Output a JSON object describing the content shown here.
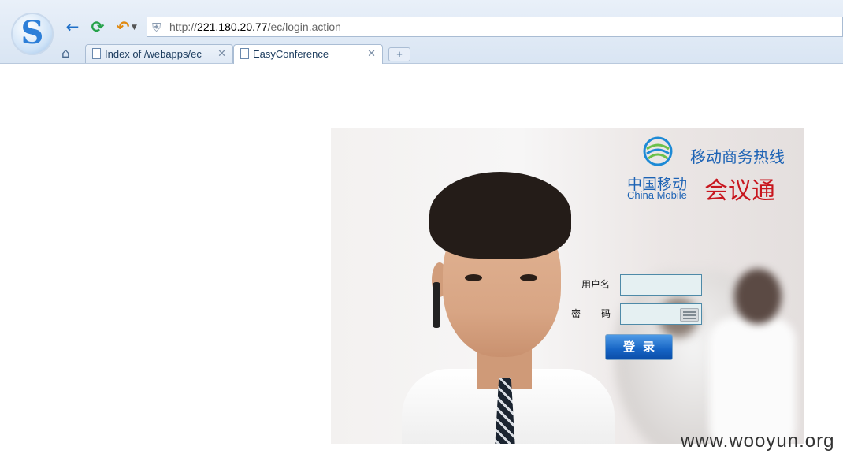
{
  "browser": {
    "url_plain": "http://",
    "url_host": "221.180.20.77",
    "url_path": "/ec/login.action",
    "tabs": [
      {
        "label": "Index of /webapps/ec",
        "active": false
      },
      {
        "label": "EasyConference",
        "active": true
      }
    ],
    "new_tab_label": "+",
    "icons": [
      "back-arrow-icon",
      "reload-icon",
      "undo-icon",
      "shield-icon",
      "home-icon",
      "page-icon",
      "close-icon"
    ]
  },
  "banner": {
    "hotline": "移动商务热线",
    "brand_cn": "中国移动",
    "brand_en": "China Mobile",
    "product": "会议通"
  },
  "login": {
    "username_label": "用户名",
    "password_label": "密码",
    "username_value": "",
    "password_value": "",
    "submit_label": "登录"
  },
  "watermark": "www.wooyun.org",
  "colors": {
    "brand_blue": "#1d63b5",
    "product_red": "#c8161e",
    "button_blue": "#1664c4"
  }
}
